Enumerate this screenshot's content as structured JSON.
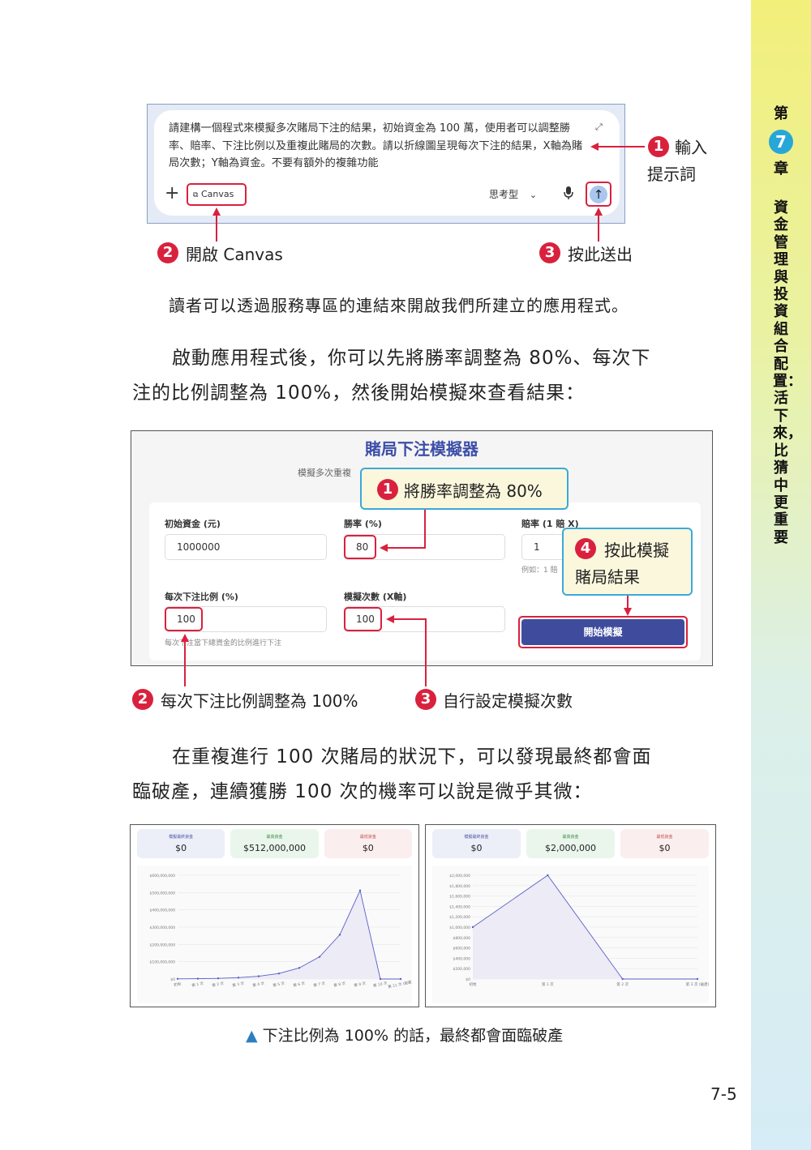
{
  "sidebar": {
    "chapter_prefix": "第",
    "chapter_number": "7",
    "chapter_suffix": "章",
    "title": "資金管理與投資組合配置：活下來，比猜中更重要"
  },
  "prompt_box": {
    "text": "請建構一個程式來模擬多次賭局下注的結果，初始資金為 100 萬，使用者可以調整勝率、賠率、下注比例以及重複此賭局的次數。請以折線圖呈現每次下注的結果，X軸為賭局次數；Y軸為資金。不要有額外的複雜功能",
    "plus": "+",
    "canvas_button": "Canvas",
    "model_selector": "思考型",
    "send_icon": "↑"
  },
  "callouts_top": [
    {
      "num": "1",
      "line1": "輸入",
      "line2": "提示詞"
    },
    {
      "num": "2",
      "text": "開啟 Canvas"
    },
    {
      "num": "3",
      "text": "按此送出"
    }
  ],
  "paragraphs": {
    "p1": "讀者可以透過服務專區的連結來開啟我們所建立的應用程式。",
    "p2_line1": "啟動應用程式後，你可以先將勝率調整為 80%、每次下",
    "p2_line2": "注的比例調整為 100%，然後開始模擬來查看結果：",
    "p3_line1": "在重複進行 100 次賭局的狀況下，可以發現最終都會面",
    "p3_line2": "臨破產，連續獲勝 100 次的機率可以說是微乎其微："
  },
  "simulator": {
    "title": "賭局下注模擬器",
    "subtitle": "模擬多次重複",
    "fields": {
      "initial_label": "初始資金 (元)",
      "initial_value": "1000000",
      "winrate_label": "勝率 (%)",
      "winrate_value": "80",
      "odds_label": "賠率 (1 賠 X)",
      "odds_value": "1",
      "odds_hint": "例如：1 賠",
      "bet_label": "每次下注比例 (%)",
      "bet_value": "100",
      "bet_hint": "每次下注當下總資金的比例進行下注",
      "count_label": "模擬次數 (X軸)",
      "count_value": "100"
    },
    "start_button": "開始模擬"
  },
  "callouts_sim": [
    {
      "num": "1",
      "text": "將勝率調整為 80%"
    },
    {
      "num": "2",
      "text": "每次下注比例調整為 100%"
    },
    {
      "num": "3",
      "text": "自行設定模擬次數"
    },
    {
      "num": "4",
      "line1": "按此模擬",
      "line2": "賭局結果"
    }
  ],
  "charts": [
    {
      "stats": [
        {
          "label": "模擬最終資金",
          "value": "$0",
          "bg": "#eceef8"
        },
        {
          "label": "最高資金",
          "value": "$512,000,000",
          "bg": "#eaf6ec"
        },
        {
          "label": "最低資金",
          "value": "$0",
          "bg": "#fbeeee"
        }
      ],
      "y_ticks": [
        "$600,000,000",
        "$500,000,000",
        "$400,000,000",
        "$300,000,000",
        "$200,000,000",
        "$100,000,000",
        "$0"
      ],
      "x_ticks": [
        "初始",
        "第 1 次",
        "第 2 次",
        "第 3 次",
        "第 4 次",
        "第 5 次",
        "第 6 次",
        "第 7 次",
        "第 8 次",
        "第 9 次",
        "第 10 次",
        "第 11 次 (破產)"
      ]
    },
    {
      "stats": [
        {
          "label": "模擬最終資金",
          "value": "$0",
          "bg": "#eceef8"
        },
        {
          "label": "最高資金",
          "value": "$2,000,000",
          "bg": "#eaf6ec"
        },
        {
          "label": "最低資金",
          "value": "$0",
          "bg": "#fbeeee"
        }
      ],
      "y_ticks": [
        "$2,000,000",
        "$1,800,000",
        "$1,600,000",
        "$1,400,000",
        "$1,200,000",
        "$1,000,000",
        "$800,000",
        "$600,000",
        "$400,000",
        "$200,000",
        "$0"
      ],
      "x_ticks": [
        "初始",
        "第 1 次",
        "第 2 次",
        "第 3 次 (破產)"
      ]
    }
  ],
  "chart_data": [
    {
      "type": "area",
      "x": [
        "初始",
        "第 1 次",
        "第 2 次",
        "第 3 次",
        "第 4 次",
        "第 5 次",
        "第 6 次",
        "第 7 次",
        "第 8 次",
        "第 9 次",
        "第 10 次",
        "第 11 次 (破產)"
      ],
      "values": [
        1000000,
        2000000,
        4000000,
        8000000,
        16000000,
        32000000,
        64000000,
        128000000,
        256000000,
        512000000,
        0,
        0
      ],
      "ylim": [
        0,
        600000000
      ]
    },
    {
      "type": "area",
      "x": [
        "初始",
        "第 1 次",
        "第 2 次",
        "第 3 次 (破產)"
      ],
      "values": [
        1000000,
        2000000,
        0,
        0
      ],
      "ylim": [
        0,
        2000000
      ]
    }
  ],
  "caption": {
    "marker": "▲",
    "text": "下注比例為 100% 的話，最終都會面臨破產"
  },
  "page_number": "7-5",
  "colors": {
    "accent_red": "#d9213e",
    "callout_blue": "#3ba9d9",
    "sim_title": "#3d4ea8",
    "start_button": "#3f4c9e"
  }
}
